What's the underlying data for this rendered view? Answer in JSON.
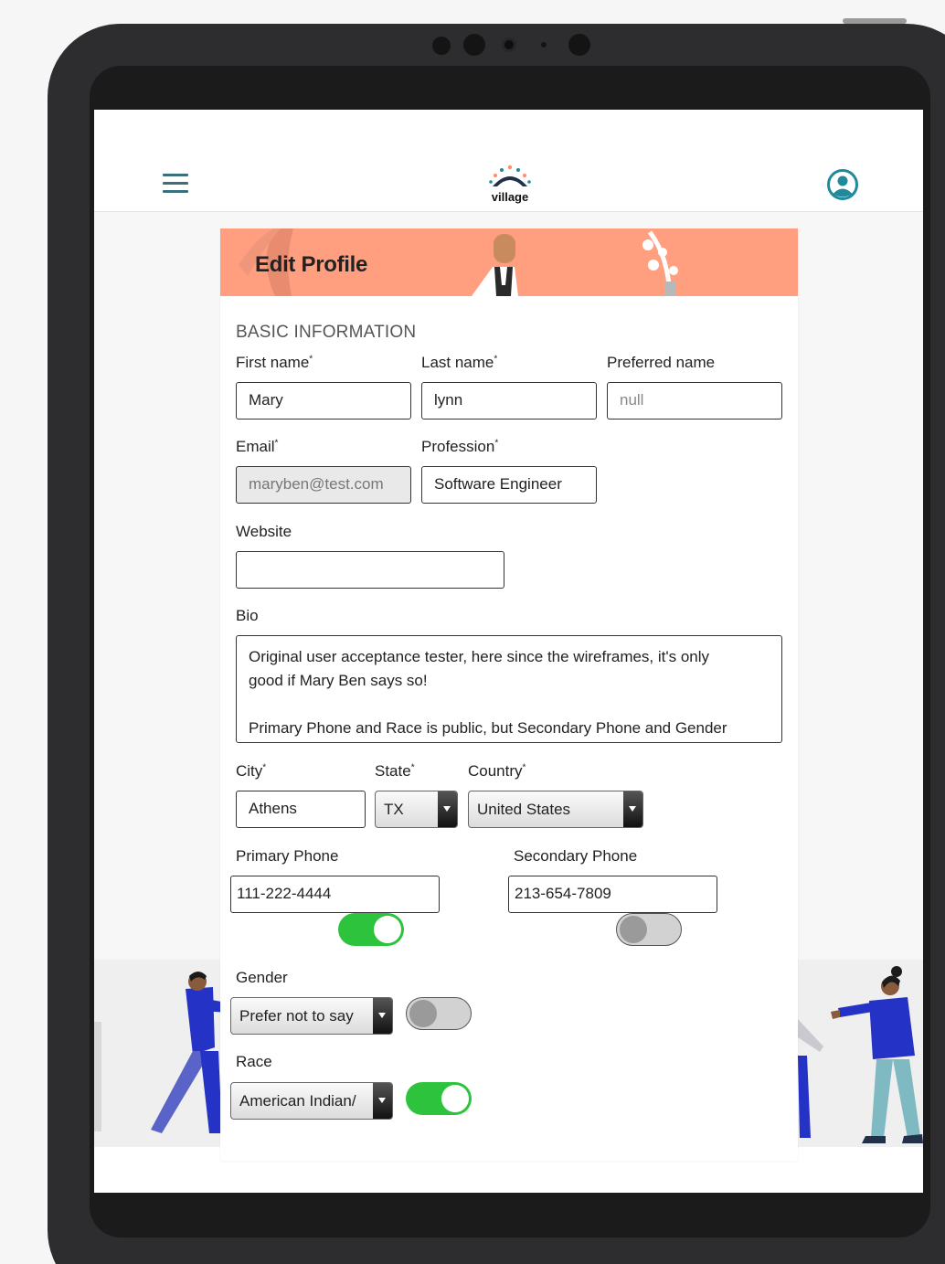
{
  "app": {
    "logo_text": "village"
  },
  "page": {
    "title": "Edit Profile",
    "section_title": "BASIC INFORMATION"
  },
  "form": {
    "first_name": {
      "label": "First name",
      "value": "Mary",
      "required": true
    },
    "last_name": {
      "label": "Last name",
      "value": "lynn",
      "required": true
    },
    "preferred_name": {
      "label": "Preferred name",
      "value": "null"
    },
    "email": {
      "label": "Email",
      "value": "maryben@test.com",
      "required": true,
      "disabled": true
    },
    "profession": {
      "label": "Profession",
      "value": "Software Engineer",
      "required": true
    },
    "website": {
      "label": "Website",
      "value": ""
    },
    "bio": {
      "label": "Bio",
      "lines": [
        "Original user acceptance tester, here since the wireframes, it's only",
        "good if Mary Ben says so!",
        "",
        "Primary Phone and Race is public, but Secondary Phone and Gender"
      ]
    },
    "city": {
      "label": "City",
      "value": "Athens",
      "required": true
    },
    "state": {
      "label": "State",
      "value": "TX",
      "required": true
    },
    "country": {
      "label": "Country",
      "value": "United States",
      "required": true
    },
    "primary_phone": {
      "label": "Primary Phone",
      "value": "111-222-4444",
      "public": true
    },
    "secondary_phone": {
      "label": "Secondary Phone",
      "value": "213-654-7809",
      "public": false
    },
    "gender": {
      "label": "Gender",
      "value": "Prefer not to say",
      "public": false
    },
    "race": {
      "label": "Race",
      "value": "American Indian/",
      "public": true
    }
  },
  "icons": {
    "menu": "hamburger-menu-icon",
    "profile": "user-circle-icon"
  },
  "colors": {
    "accent": "#1f8a9a",
    "banner": "#ff9f80",
    "toggle_on": "#2ec33c",
    "toggle_off": "#d2d2d2",
    "illustration_blue": "#2433c5"
  }
}
